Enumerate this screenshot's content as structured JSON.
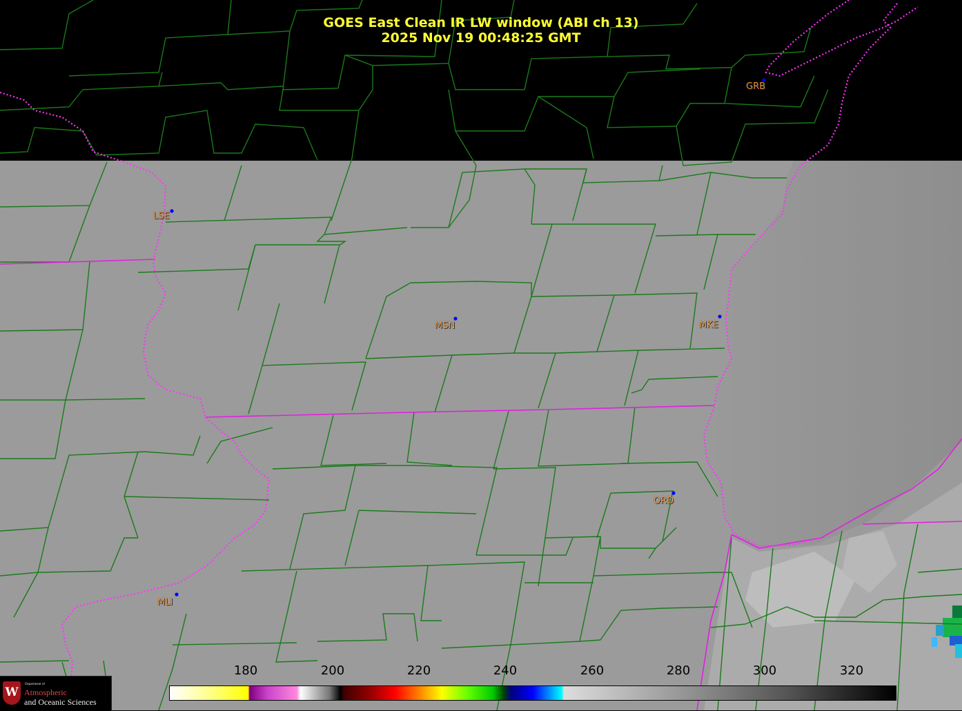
{
  "title": {
    "line1": "GOES East Clean IR LW window (ABI ch 13)",
    "line2": "2025 Nov 19  00:48:25 GMT"
  },
  "stations": [
    {
      "code": "GRB"
    },
    {
      "code": "LSE"
    },
    {
      "code": "MSN"
    },
    {
      "code": "MKE"
    },
    {
      "code": "ORD"
    },
    {
      "code": "MLI"
    }
  ],
  "colorbar": {
    "ticks": [
      "180",
      "200",
      "220",
      "240",
      "260",
      "280",
      "300",
      "320"
    ]
  },
  "logo": {
    "crest": "W",
    "dept": "Department of",
    "line1": "Atmospheric",
    "line2": "and Oceanic Sciences"
  },
  "colors": {
    "title": "#ffff33",
    "county_lines": "#1a7a1a",
    "state_lines": "#e020e0",
    "station_label": "#f2a75a",
    "station_dot": "#0000ff",
    "land_gray": "#999999"
  }
}
